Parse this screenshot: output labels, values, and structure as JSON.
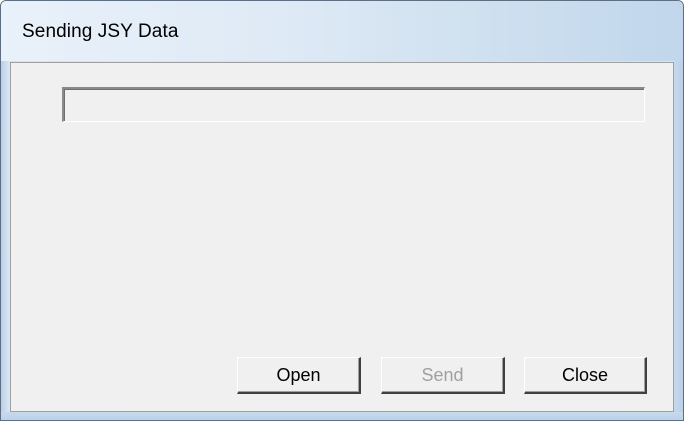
{
  "window": {
    "title": "Sending JSY Data"
  },
  "status_field": {
    "value": ""
  },
  "buttons": {
    "open_label": "Open",
    "send_label": "Send",
    "close_label": "Close",
    "send_enabled": false
  }
}
